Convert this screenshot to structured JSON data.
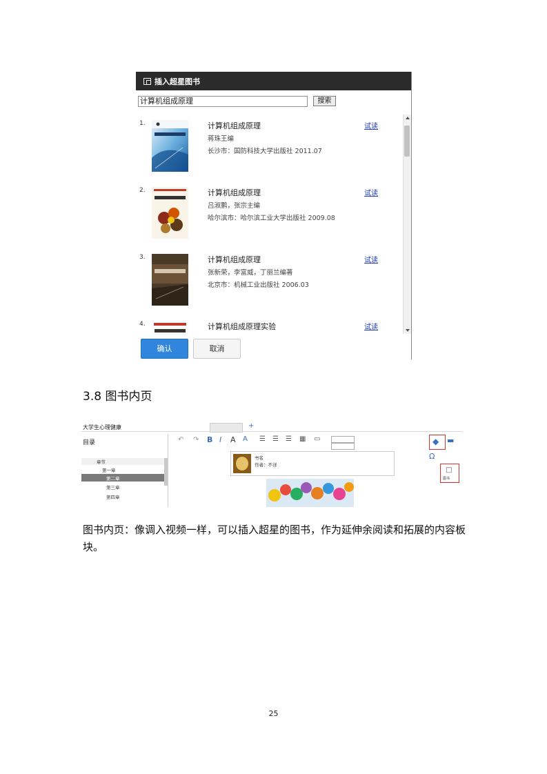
{
  "dialog": {
    "title": "插入超星图书",
    "search_value": "计算机组成原理",
    "search_button": "搜索",
    "items": [
      {
        "num": "1.",
        "title": "计算机组成原理",
        "author": "蒋珠王编",
        "publisher": "长沙市：国防科技大学出版社 2011.07",
        "trial": "试读",
        "cover_text": "计算机组成原理"
      },
      {
        "num": "2.",
        "title": "计算机组成原理",
        "author": "吕淑鹏，张宗主编",
        "publisher": "哈尔滨市：哈尔滨工业大学出版社 2009.08",
        "trial": "试读",
        "cover_text": "计算机组成原理"
      },
      {
        "num": "3.",
        "title": "计算机组成原理",
        "author": "张新荣，李富威，丁丽兰编著",
        "publisher": "北京市：机械工业出版社 2006.03",
        "trial": "试读",
        "cover_text": "计算机组成原理"
      },
      {
        "num": "4.",
        "title": "计算机组成原理实验",
        "author": "",
        "publisher": "",
        "trial": "试读",
        "cover_text": "计算机组成原理实验"
      }
    ],
    "confirm": "确认",
    "cancel": "取消"
  },
  "section_heading": "3.8 图书内页",
  "editor": {
    "doc_title": "大学生心理健康",
    "toc_label": "目录",
    "toc_items": [
      "章节",
      "第一章",
      "第二章",
      "第三章",
      "第四章"
    ],
    "book_card_lines": [
      "书名",
      "作者：不详"
    ],
    "insert_book_label": "图书"
  },
  "paragraph": "图书内页：像调入视频一样，可以插入超星的图书，作为延伸余阅读和拓展的内容板块。",
  "page_number": "25"
}
